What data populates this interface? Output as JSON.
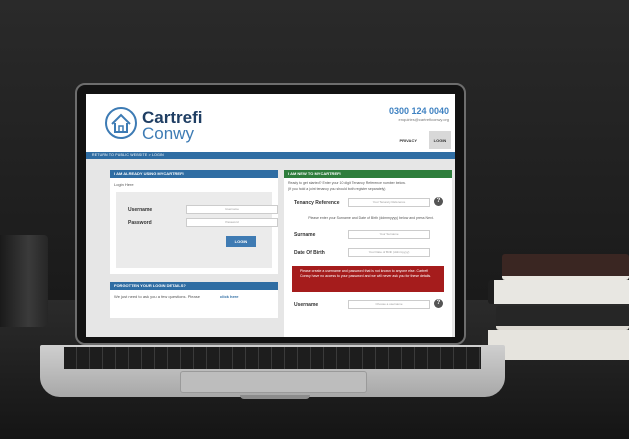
{
  "brand": {
    "name_line1": "Cartrefi",
    "name_line2": "Conwy"
  },
  "contact": {
    "phone": "0300 124 0040",
    "email": "enquiries@cartreficonwy.org"
  },
  "top_links": {
    "privacy": "PRIVACY",
    "login": "LOGIN"
  },
  "breadcrumb": "RETURN TO PUBLIC WEBSITE  >  LOGIN",
  "login_panel": {
    "title": "I AM ALREADY USING MYCARTREFI",
    "subtitle": "Login Here",
    "username_label": "Username",
    "username_placeholder": "Username",
    "password_label": "Password",
    "password_placeholder": "Password",
    "button": "LOGIN"
  },
  "forgot_panel": {
    "title": "FORGOTTEN YOUR LOGIN DETAILS?",
    "text": "We just need to ask you a few questions. Please",
    "link": "click here"
  },
  "register_panel": {
    "title": "I AM NEW TO MYCARTREFI",
    "intro1": "Ready to get started? Enter your 10 digit Tenancy Reference number below.",
    "intro2": "(If you hold a joint tenancy you should both register separately)",
    "tenancy_label": "Tenancy Reference",
    "tenancy_placeholder": "Your Tenancy Reference",
    "instructions": "Please enter your Surname and Date of Birth (ddmmyyyy) below and press Next.",
    "surname_label": "Surname",
    "surname_placeholder": "Your Surname",
    "dob_label": "Date Of Birth",
    "dob_placeholder": "Your Date of Birth (ddmmyyyy)",
    "warning": "Please create a username and password that is not known to anyone else. Cartrefi Conwy have no access to your password and we will never ask you for these details.",
    "username_label": "Username",
    "username_placeholder": "Choose a username"
  },
  "colors": {
    "blue": "#2f6da3",
    "green": "#2e7d3c",
    "red": "#a51c1c"
  }
}
